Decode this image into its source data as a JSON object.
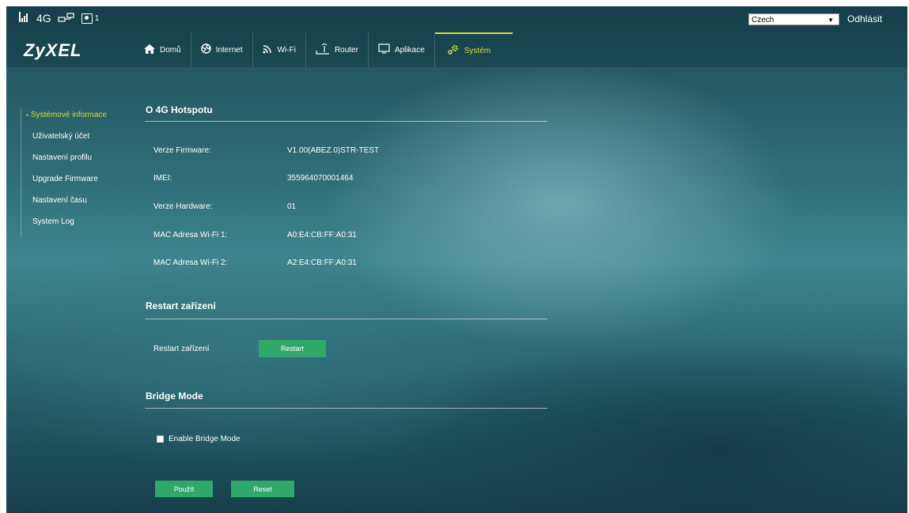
{
  "status": {
    "signal_label": "4G",
    "sim_count": "1"
  },
  "header": {
    "language": "Czech",
    "logout_label": "Odhlásit",
    "logo": "ZyXEL"
  },
  "nav": {
    "tabs": [
      {
        "label": "Domů",
        "icon": "home-icon"
      },
      {
        "label": "Internet",
        "icon": "globe-icon"
      },
      {
        "label": "Wi-Fi",
        "icon": "wifi-icon"
      },
      {
        "label": "Router",
        "icon": "router-icon"
      },
      {
        "label": "Aplikace",
        "icon": "monitor-icon"
      },
      {
        "label": "Systém",
        "icon": "gear-icon"
      }
    ],
    "active_tab": "Systém",
    "accent_color": "#d6dd3a"
  },
  "sidebar": {
    "items": [
      {
        "label": "Systémové informace"
      },
      {
        "label": "Uživatelský účet"
      },
      {
        "label": "Nastavení profilu"
      },
      {
        "label": "Upgrade Firmware"
      },
      {
        "label": "Nastavení času"
      },
      {
        "label": "System Log"
      }
    ],
    "active_item": "Systémové informace"
  },
  "about": {
    "title": "O 4G Hotspotu",
    "rows": [
      {
        "label": "Verze Firmware:",
        "value": "V1.00(ABEZ.0)STR-TEST"
      },
      {
        "label": "IMEI:",
        "value": "355964070001464"
      },
      {
        "label": "Verze Hardware:",
        "value": "01"
      },
      {
        "label": "MAC Adresa Wi-Fi 1:",
        "value": "A0:E4:CB:FF:A0:31"
      },
      {
        "label": "MAC Adresa Wi-Fi 2:",
        "value": "A2:E4:CB:FF:A0:31"
      }
    ]
  },
  "restart": {
    "title": "Restart zařízení",
    "label": "Restart zařízení",
    "button": "Restart"
  },
  "bridge": {
    "title": "Bridge Mode",
    "checkbox_label": "Enable Bridge Mode",
    "checked": false
  },
  "actions": {
    "apply": "Použít",
    "reset": "Reset"
  },
  "colors": {
    "button_green": "#2fa86a"
  }
}
